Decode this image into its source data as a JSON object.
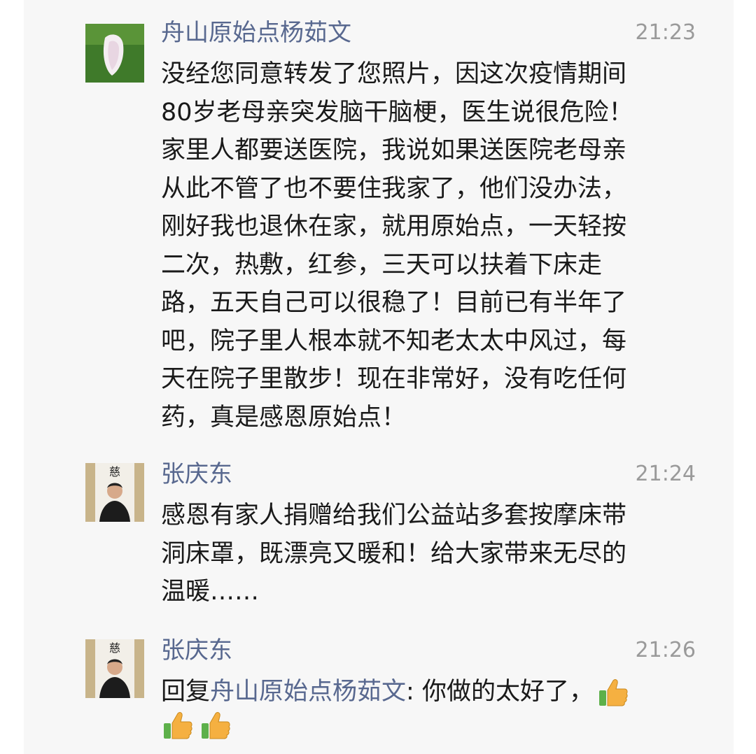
{
  "comments": [
    {
      "author": "舟山原始点杨茹文",
      "time": "21:23",
      "avatar_icon": "white-flower-petal-avatar",
      "text": "没经您同意转发了您照片，因这次疫情期间\n80岁老母亲突发脑干脑梗，医生说很危险！\n家里人都要送医院，我说如果送医院老母亲\n从此不管了也不要住我家了，他们没办法，\n刚好我也退休在家，就用原始点，一天轻按\n二次，热敷，红参，三天可以扶着下床走\n路，五天自己可以很稳了！目前已有半年了\n吧，院子里人根本就不知老太太中风过，每\n天在院子里散步！现在非常好，没有吃任何\n药，真是感恩原始点！"
    },
    {
      "author": "张庆东",
      "time": "21:24",
      "avatar_icon": "man-portrait-avatar",
      "text": "感恩有家人捐赠给我们公益站多套按摩床带\n洞床罩，既漂亮又暖和！给大家带来无尽的\n温暖……"
    },
    {
      "author": "张庆东",
      "time": "21:26",
      "avatar_icon": "man-portrait-avatar",
      "reply_prefix": "回复",
      "reply_to": "舟山原始点杨茹文",
      "reply_text": ": 你做的太好了，",
      "emojis": [
        "thumbs-up-icon",
        "thumbs-up-icon",
        "thumbs-up-icon"
      ]
    }
  ],
  "colors": {
    "author": "#58688f",
    "time": "#9a9a9a",
    "text": "#1a1a1a",
    "panel": "#f7f7f7",
    "thumb": "#f5b041",
    "thumb_cuff": "#5db04a"
  }
}
